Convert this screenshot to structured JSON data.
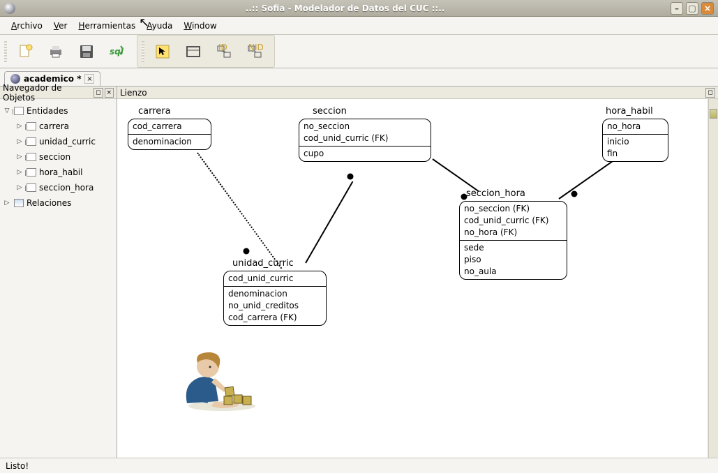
{
  "titlebar": {
    "title": "..:: Sofia - Modelador de Datos del CUC ::.."
  },
  "menu": {
    "archivo": "Archivo",
    "ver": "Ver",
    "herramientas": "Herramientas",
    "ayuda": "Ayuda",
    "window": "Window"
  },
  "tab": {
    "label": "academico *",
    "close": "×"
  },
  "sidebar": {
    "header": "Navegador de Objetos",
    "root_ent": "Entidades",
    "items": [
      "carrera",
      "unidad_curric",
      "seccion",
      "hora_habil",
      "seccion_hora"
    ],
    "root_rel": "Relaciones"
  },
  "canvas": {
    "header": "Lienzo",
    "entities": {
      "carrera": {
        "title": "carrera",
        "pk": [
          "cod_carrera"
        ],
        "attrs": [
          "denominacion"
        ]
      },
      "seccion": {
        "title": "seccion",
        "pk": [
          "no_seccion",
          "cod_unid_curric (FK)"
        ],
        "attrs": [
          "cupo"
        ]
      },
      "hora_habil": {
        "title": "hora_habil",
        "pk": [
          "no_hora"
        ],
        "attrs": [
          "inicio",
          "fin"
        ]
      },
      "unidad_curric": {
        "title": "unidad_curric",
        "pk": [
          "cod_unid_curric"
        ],
        "attrs": [
          "denominacion",
          "no_unid_creditos",
          "cod_carrera (FK)"
        ]
      },
      "seccion_hora": {
        "title": "seccion_hora",
        "pk": [
          "no_seccion (FK)",
          "cod_unid_curric (FK)",
          "no_hora (FK)"
        ],
        "attrs": [
          "sede",
          "piso",
          "no_aula"
        ]
      }
    }
  },
  "status": {
    "text": "Listo!"
  }
}
